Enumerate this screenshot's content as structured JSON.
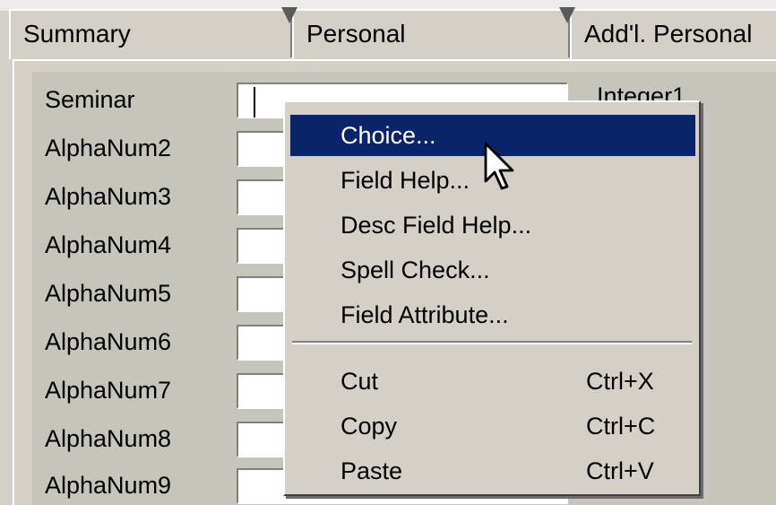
{
  "tabs": [
    {
      "label": "Summary"
    },
    {
      "label": "Personal"
    },
    {
      "label": "Add'l. Personal"
    }
  ],
  "form": {
    "fields": [
      {
        "label": "Seminar",
        "value": ""
      },
      {
        "label": "AlphaNum2",
        "value": ""
      },
      {
        "label": "AlphaNum3",
        "value": ""
      },
      {
        "label": "AlphaNum4",
        "value": ""
      },
      {
        "label": "AlphaNum5",
        "value": ""
      },
      {
        "label": "AlphaNum6",
        "value": ""
      },
      {
        "label": "AlphaNum7",
        "value": ""
      },
      {
        "label": "AlphaNum8",
        "value": ""
      },
      {
        "label": "AlphaNum9",
        "value": ""
      }
    ],
    "right_label": "Integer1"
  },
  "context_menu": {
    "items": [
      {
        "label": "Choice...",
        "selected": true
      },
      {
        "label": "Field Help..."
      },
      {
        "label": "Desc Field Help..."
      },
      {
        "label": "Spell Check..."
      },
      {
        "label": "Field Attribute..."
      },
      {
        "label": "Cut",
        "shortcut": "Ctrl+X"
      },
      {
        "label": "Copy",
        "shortcut": "Ctrl+C"
      },
      {
        "label": "Paste",
        "shortcut": "Ctrl+V"
      }
    ]
  },
  "colors": {
    "selection": "#0a246a",
    "face": "#d4d0c8"
  }
}
